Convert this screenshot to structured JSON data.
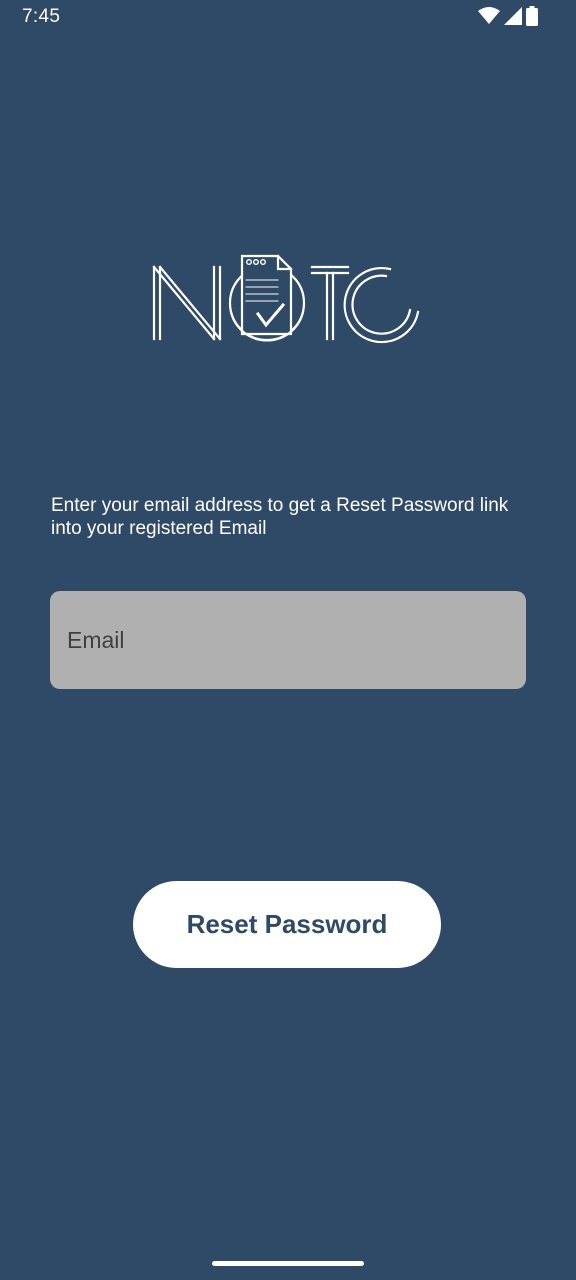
{
  "status_bar": {
    "time": "7:45",
    "icons": [
      "wifi-icon",
      "cellular-signal-icon",
      "battery-icon"
    ]
  },
  "logo": {
    "text": "NOTO",
    "icon": "note-check-icon"
  },
  "instruction": "Enter your email address to get a Reset Password link into your registered Email",
  "email": {
    "placeholder": "Email",
    "value": ""
  },
  "reset_button": {
    "label": "Reset Password"
  },
  "colors": {
    "background": "#2e4a66",
    "field": "#b0b0b0",
    "button": "#ffffff",
    "button_text": "#2e4a66"
  }
}
